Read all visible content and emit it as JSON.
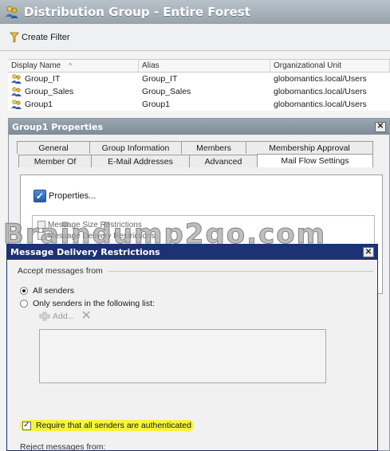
{
  "console": {
    "title": "Distribution Group - Entire Forest",
    "toolbar": {
      "create_filter": "Create Filter"
    },
    "columns": [
      "Display Name",
      "Alias",
      "Organizational Unit"
    ],
    "sort_indicator": "^",
    "rows": [
      {
        "display_name": "Group_IT",
        "alias": "Group_IT",
        "ou": "globomantics.local/Users"
      },
      {
        "display_name": "Group_Sales",
        "alias": "Group_Sales",
        "ou": "globomantics.local/Users"
      },
      {
        "display_name": "Group1",
        "alias": "Group1",
        "ou": "globomantics.local/Users"
      }
    ]
  },
  "properties_dialog": {
    "title": "Group1 Properties",
    "close": "✕",
    "tabs_row1": [
      "General",
      "Group Information",
      "Members",
      "Membership Approval"
    ],
    "tabs_row2": [
      "Member Of",
      "E-Mail Addresses",
      "Advanced",
      "Mail Flow Settings"
    ],
    "active_tab": "Mail Flow Settings",
    "properties_button": "Properties...",
    "mail_flow_items": [
      "Message Size Restrictions",
      "Message Delivery Restrictions"
    ]
  },
  "watermark": "Braindump2go.com",
  "restrictions_dialog": {
    "title": "Message Delivery Restrictions",
    "close": "✕",
    "accept_from_label": "Accept messages from",
    "radio_all": "All senders",
    "radio_only": "Only senders in the following list:",
    "selected_option": "All senders",
    "add_label": "Add...",
    "require_auth_label": "Require that all senders are authenticated",
    "require_auth_checked": true,
    "reject_from_label": "Reject messages from:",
    "highlight_color": "#f4f53d"
  },
  "colors": {
    "console_title_bg": "#a9b4bc",
    "restrictions_title_bg": "#1d3275",
    "properties_title_bg": "#8a96a2"
  }
}
